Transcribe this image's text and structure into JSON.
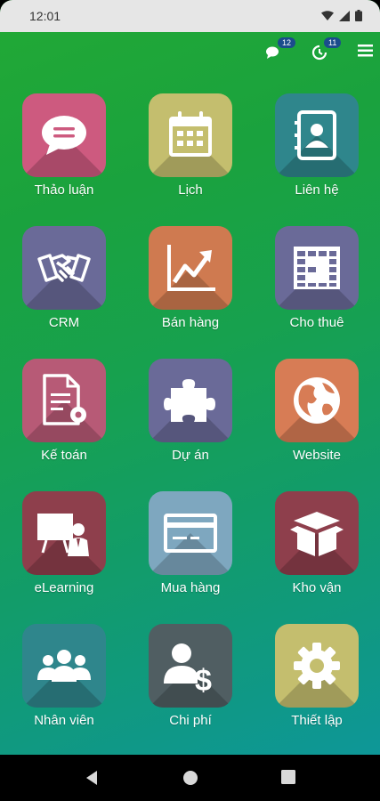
{
  "status": {
    "time": "12:01"
  },
  "topbar": {
    "chat_count": "12",
    "activity_count": "11"
  },
  "apps": [
    {
      "label": "Thảo luận",
      "color": "#cd5a7f",
      "icon": "chat-icon"
    },
    {
      "label": "Lịch",
      "color": "#c4be6e",
      "icon": "calendar-icon"
    },
    {
      "label": "Liên hệ",
      "color": "#2f868c",
      "icon": "contact-icon"
    },
    {
      "label": "CRM",
      "color": "#6a6a98",
      "icon": "handshake-icon"
    },
    {
      "label": "Bán hàng",
      "color": "#cf7a50",
      "icon": "chart-trend-icon"
    },
    {
      "label": "Cho thuê",
      "color": "#6a6a98",
      "icon": "rental-icon"
    },
    {
      "label": "Kế toán",
      "color": "#b75a76",
      "icon": "document-gear-icon"
    },
    {
      "label": "Dự án",
      "color": "#6a6a98",
      "icon": "puzzle-icon"
    },
    {
      "label": "Website",
      "color": "#d77c55",
      "icon": "globe-icon"
    },
    {
      "label": "eLearning",
      "color": "#8e3f4c",
      "icon": "teacher-icon"
    },
    {
      "label": "Mua hàng",
      "color": "#7ea7bf",
      "icon": "credit-card-icon"
    },
    {
      "label": "Kho vận",
      "color": "#8e3f4c",
      "icon": "box-icon"
    },
    {
      "label": "Nhân viên",
      "color": "#2f868c",
      "icon": "team-icon"
    },
    {
      "label": "Chi phí",
      "color": "#505e62",
      "icon": "user-dollar-icon"
    },
    {
      "label": "Thiết lập",
      "color": "#c4be6e",
      "icon": "gear-icon"
    }
  ]
}
